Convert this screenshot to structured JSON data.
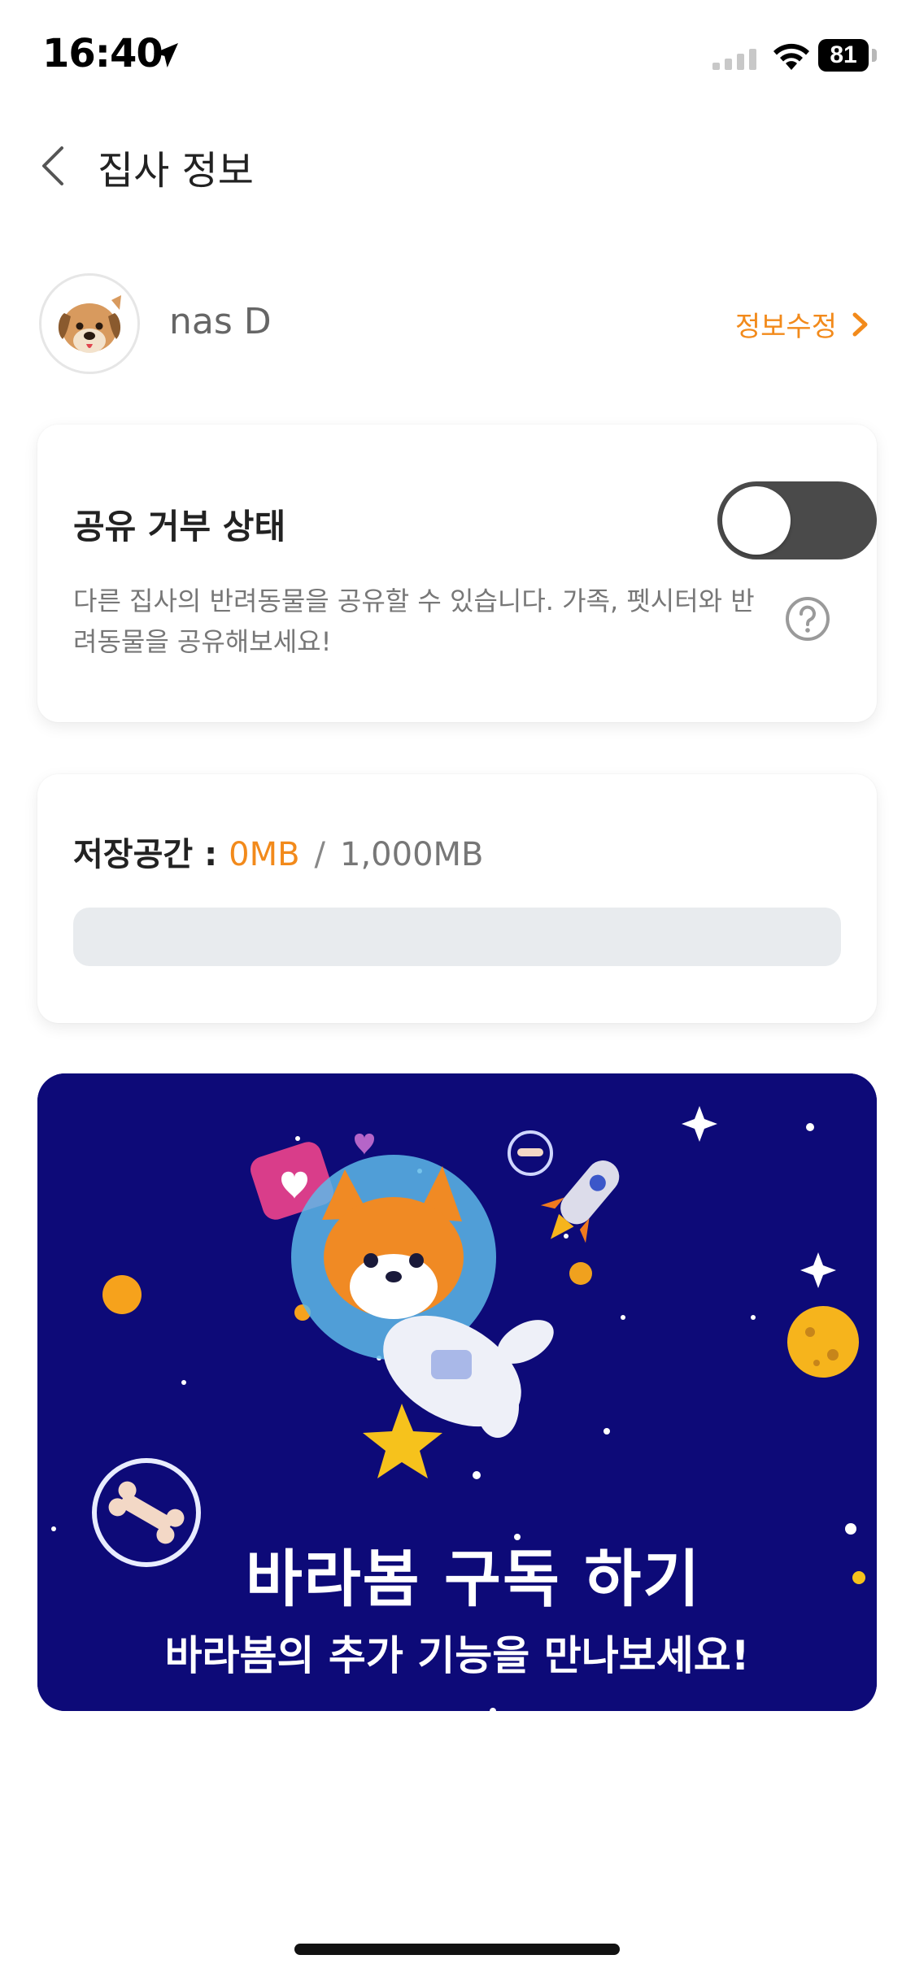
{
  "status_bar": {
    "time": "16:40",
    "battery": "81",
    "icons": [
      "location-arrow-icon",
      "cellular-signal-icon",
      "wifi-icon",
      "battery-icon"
    ]
  },
  "header": {
    "title": "집사 정보",
    "back_icon": "chevron-left-icon"
  },
  "profile": {
    "name": "nas D",
    "avatar_icon": "dog-avatar-icon",
    "edit_label": "정보수정",
    "edit_icon": "chevron-right-icon"
  },
  "sharing": {
    "title": "공유 거부 상태",
    "toggle_on": false,
    "description": "다른 집사의 반려동물을 공유할 수 있습니다. 가족, 펫시터와 반려동물을 공유해보세요!",
    "help_icon": "question-circle-icon"
  },
  "storage": {
    "label": "저장공간 :",
    "used": "0MB",
    "separator": "/",
    "total": "1,000MB",
    "used_fraction": 0
  },
  "banner": {
    "title": "바라봄 구독 하기",
    "subtitle": "바라봄의 추가 기능을 만나보세요!",
    "illustration": "astronaut-corgi-illustration"
  },
  "colors": {
    "accent": "#f28a1b",
    "banner_background": "#0d0a78",
    "toggle_off": "#4a4a4a",
    "track": "#e8ebee"
  }
}
